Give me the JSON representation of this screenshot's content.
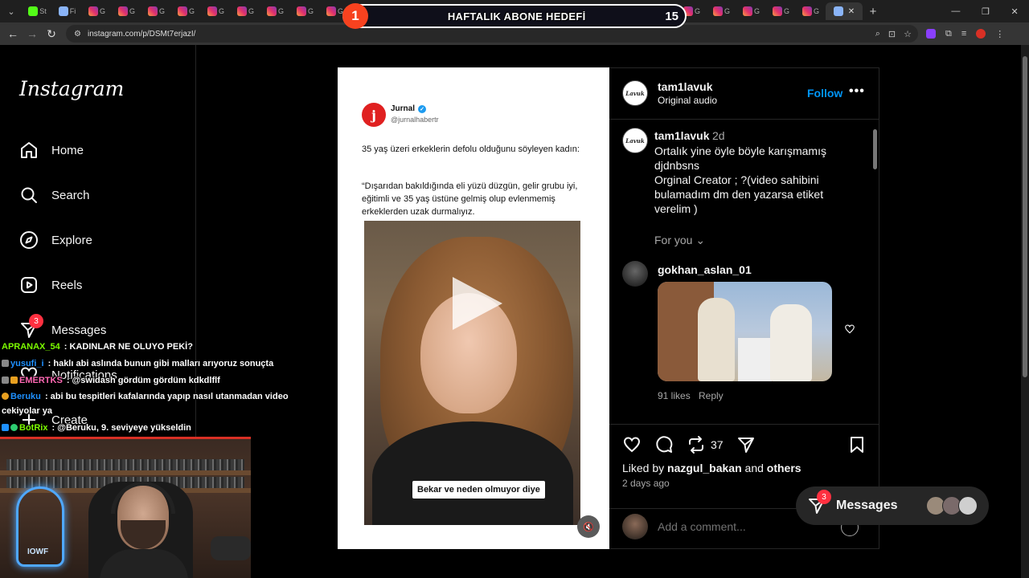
{
  "browser": {
    "url": "instagram.com/p/DSMt7erjazI/",
    "tab_labels": {
      "kick": "St",
      "generic": "Fi",
      "ig": "G"
    },
    "active_tab_close": "✕",
    "new_tab": "+"
  },
  "stream_overlay": {
    "left_number": "1",
    "goal_label": "HAFTALIK ABONE HEDEFİ",
    "right_number": "15"
  },
  "sidebar": {
    "logo": "Instagram",
    "items": [
      {
        "label": "Home",
        "icon": "home-icon"
      },
      {
        "label": "Search",
        "icon": "search-icon"
      },
      {
        "label": "Explore",
        "icon": "compass-icon"
      },
      {
        "label": "Reels",
        "icon": "reels-icon"
      },
      {
        "label": "Messages",
        "icon": "messenger-icon",
        "badge": "3"
      },
      {
        "label": "Notifications",
        "icon": "heart-icon"
      },
      {
        "label": "Create",
        "icon": "plus-icon"
      }
    ]
  },
  "post": {
    "tweet": {
      "avatar_letter": "j",
      "name": "Jurnal",
      "handle": "@jurnalhabertr",
      "line1": "35 yaş üzeri erkeklerin defolu olduğunu söyleyen kadın:",
      "line2": "“Dışarıdan bakıldığında eli yüzü düzgün, gelir grubu iyi, eğitimli ve 35 yaş üstüne gelmiş olup evlenmemiş erkeklerden uzak durmalıyız."
    },
    "video_caption": "Bekar ve neden olmuyor diye",
    "author": {
      "username": "tam1lavuk",
      "avatar_text": "Lavuk",
      "audio": "Original audio",
      "follow_label": "Follow",
      "more_label": "•••"
    },
    "caption": {
      "username": "tam1lavuk",
      "time": "2d",
      "text": "Ortalık yine öyle böyle karışmamış djdnbsns\nOrginal Creator ; ?(video sahibini bulamadım dm den yazarsa etiket verelim )"
    },
    "for_you_label": "For you ⌄",
    "comment": {
      "username": "gokhan_aslan_01",
      "likes": "91 likes",
      "reply_label": "Reply"
    },
    "repost_count": "37",
    "liked_by": {
      "prefix": "Liked by ",
      "user": "nazgul_bakan",
      "middle": " and ",
      "others": "others"
    },
    "posted": "2 days ago",
    "add_comment_placeholder": "Add a comment..."
  },
  "messages_pill": {
    "label": "Messages",
    "badge": "3",
    "avatar_colors": [
      "#9a8a7a",
      "#7a6a6a",
      "#cfcfcf"
    ]
  },
  "chat": [
    {
      "user": "APRANAX_54",
      "user_color": "#7CFC00",
      "text": " : KADINLAR NE OLUYO PEKİ?"
    },
    {
      "user": "yusufi_i",
      "user_color": "#1e90ff",
      "text": " : haklı abi aslında bunun gibi malları arıyoruz sonuçta"
    },
    {
      "user": "EMERTKS",
      "user_color": "#ff69b4",
      "text": " : @swidash gördüm gördüm kdkdlflf"
    },
    {
      "user": "Beruku",
      "user_color": "#1e90ff",
      "text": " : abi bu tespitleri kafalarında yapıp nasıl utanmadan video"
    },
    {
      "user": "",
      "user_color": "#ffffff",
      "text": "cekiyolar ya"
    },
    {
      "user": "BotRix",
      "user_color": "#7CFC00",
      "text": " : @Beruku, 9. seviyeye yükseldin"
    }
  ],
  "webcam": {
    "neon_text": "IOWF"
  },
  "colors": {
    "ig_blue": "#0095f6",
    "badge_red": "#ff3040",
    "overlay_red": "#f7421f"
  }
}
